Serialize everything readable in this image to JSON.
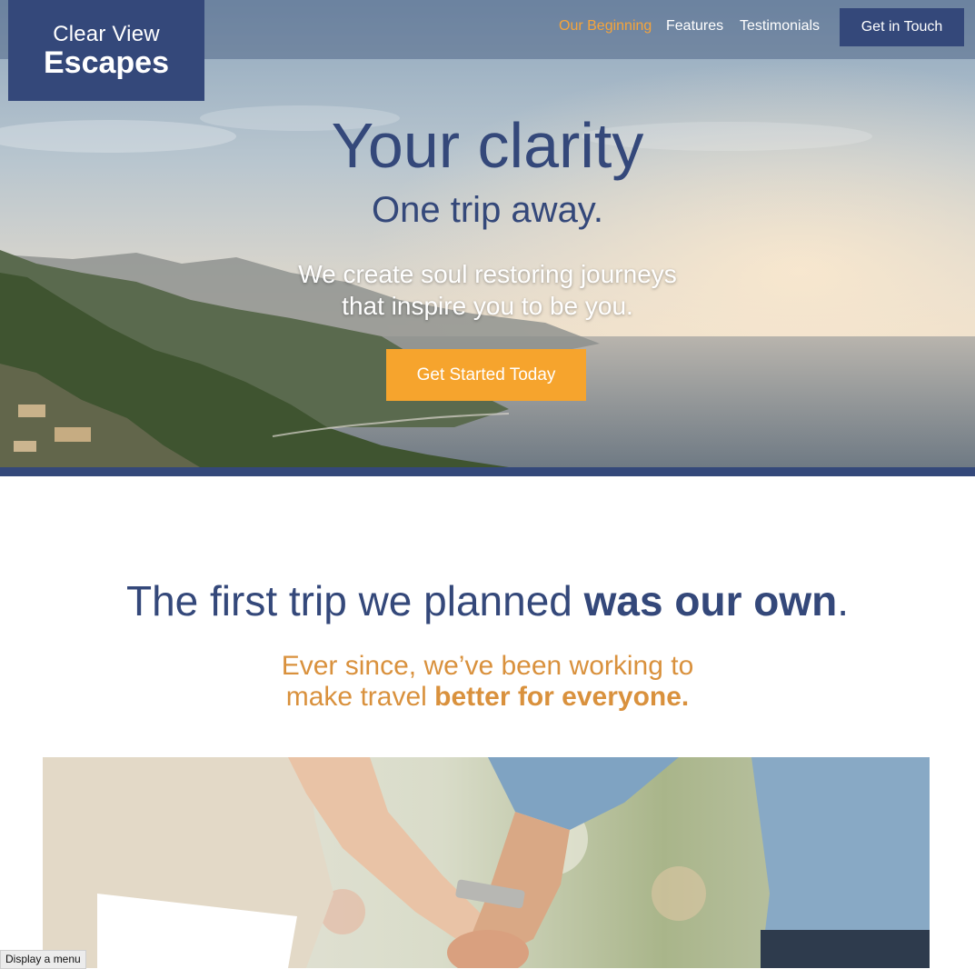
{
  "brand": {
    "line1": "Clear View",
    "line2": "Escapes"
  },
  "nav": {
    "items": [
      {
        "label": "Our Beginning",
        "active": true
      },
      {
        "label": "Features",
        "active": false
      },
      {
        "label": "Testimonials",
        "active": false
      }
    ],
    "cta_label": "Get in Touch"
  },
  "hero": {
    "title": "Your clarity",
    "subtitle": "One trip away.",
    "lead_line1": "We create soul restoring journeys",
    "lead_line2": "that inspire you to be you.",
    "button_label": "Get Started Today"
  },
  "story": {
    "title_part1": "The first trip we planned ",
    "title_part2": "was our own",
    "title_part3": ".",
    "lead_line1": "Ever since, we’ve been working to",
    "lead_line2_normal": "make travel ",
    "lead_line2_bold": "better for everyone."
  },
  "tooltip": "Display a menu",
  "colors": {
    "brand_navy": "#34487a",
    "accent_orange": "#f6a42d",
    "accent_gold": "#d9913d"
  }
}
